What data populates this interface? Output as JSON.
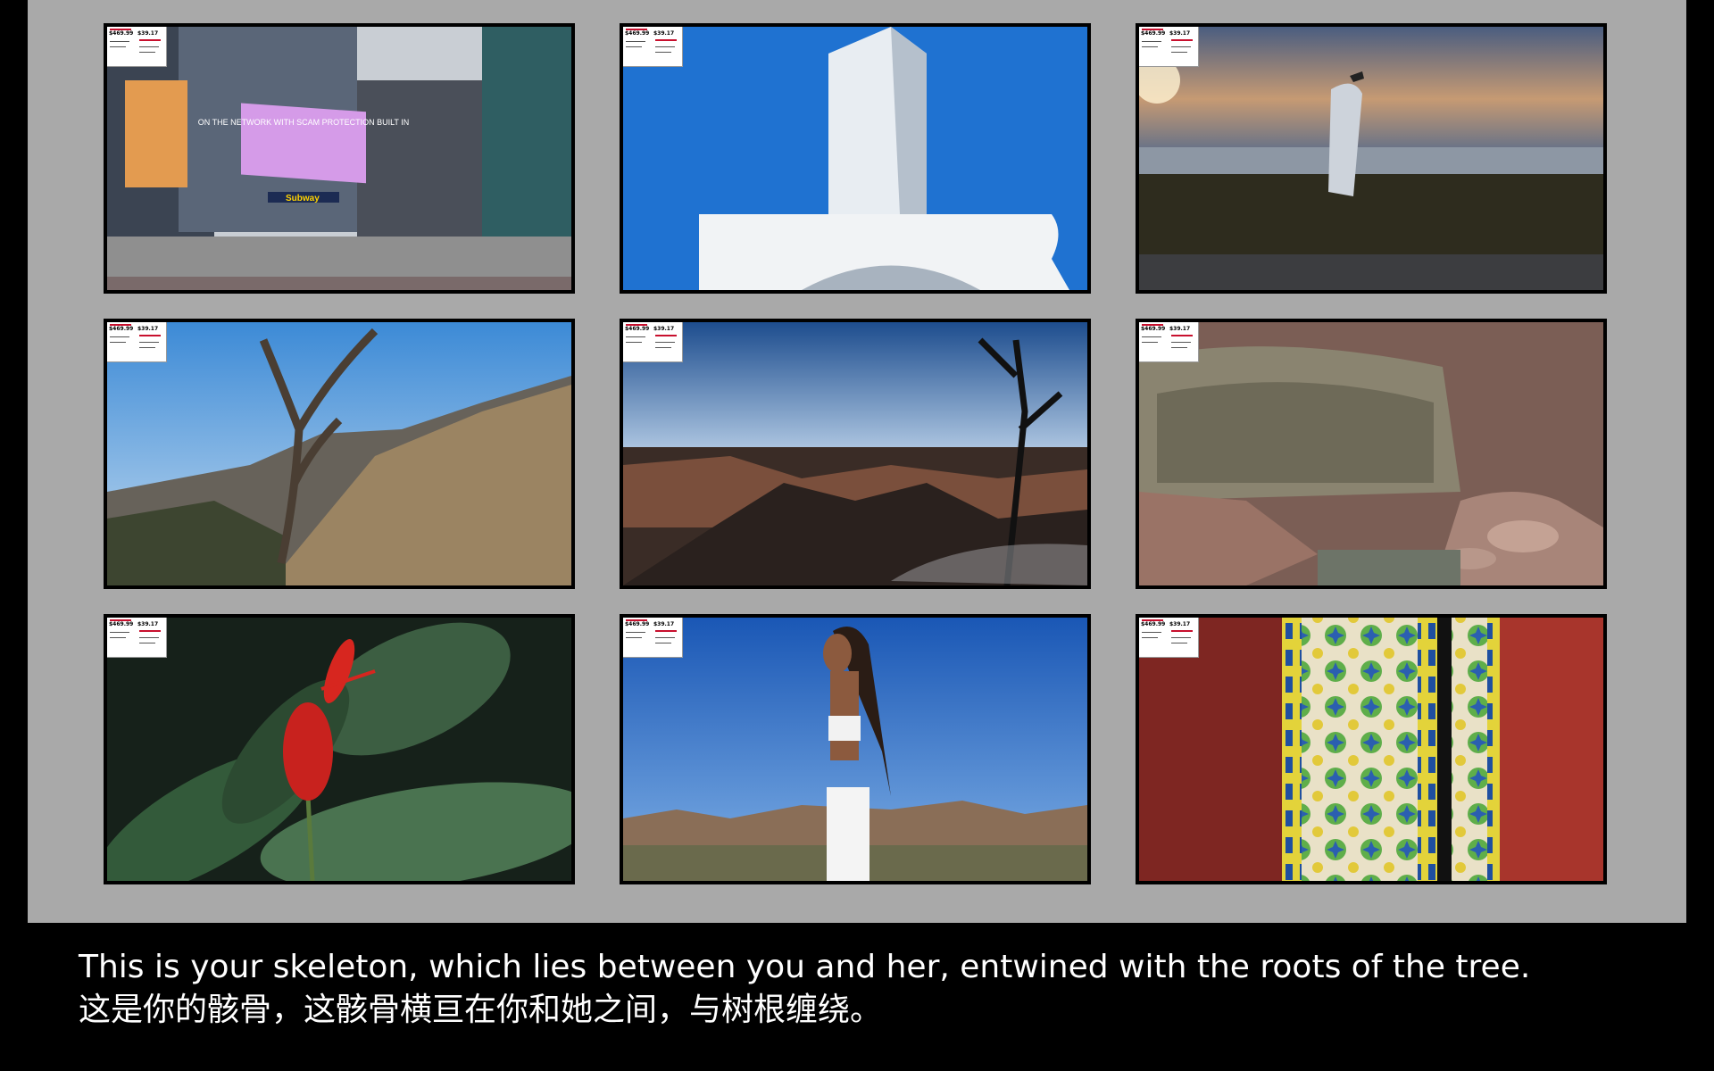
{
  "price_tag": {
    "price": "$469.99",
    "monthly": "$39.17"
  },
  "photos": [
    {
      "subject": "Times Square street with Subway sign and billboard",
      "billboard_text": "ON THE NETWORK WITH SCAM PROTECTION BUILT IN",
      "store_sign": "Subway"
    },
    {
      "subject": "White curved skyscraper against blue sky"
    },
    {
      "subject": "Seagull on surfboard sculpture at waterfront sunset"
    },
    {
      "subject": "Twisted dead tree on desert mountain slope"
    },
    {
      "subject": "Grand Canyon at dusk with silhouetted tree"
    },
    {
      "subject": "Sandstone rock alcove with boulders"
    },
    {
      "subject": "Red flower bud on green leaves"
    },
    {
      "subject": "Woman with long braids in desert under blue sky"
    },
    {
      "subject": "Colorful Moorish tiles on red wall"
    }
  ],
  "caption": {
    "english": "This is your skeleton, which lies between you and her, entwined with the roots of the tree.",
    "chinese": "这是你的骸骨，这骸骨横亘在你和她之间，与树根缠绕。"
  }
}
